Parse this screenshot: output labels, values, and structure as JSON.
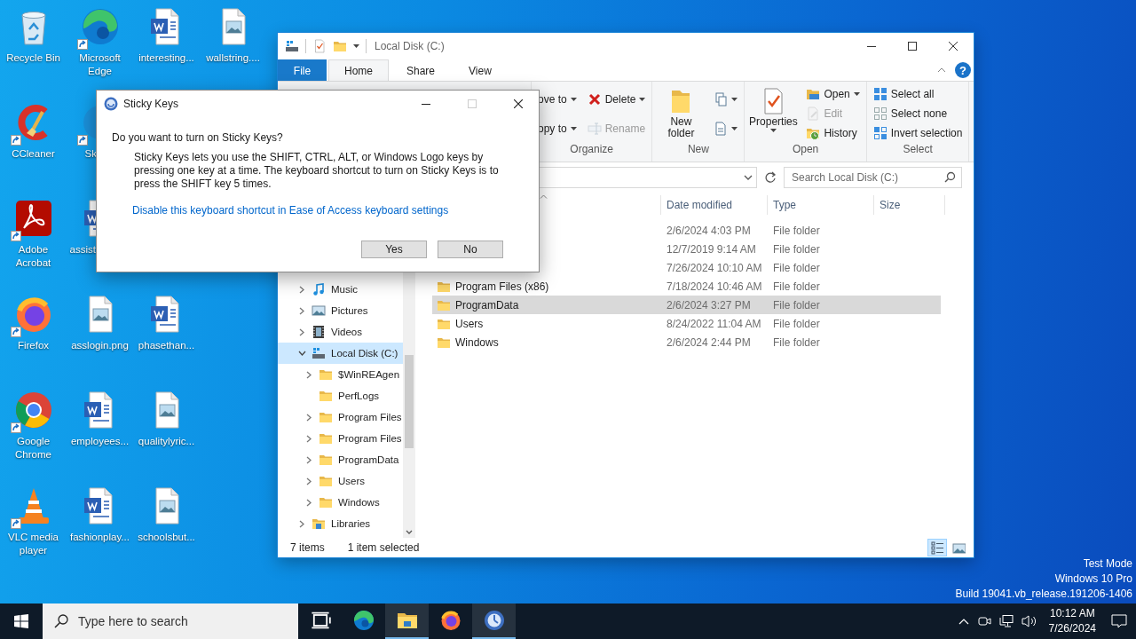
{
  "desktop_icons": [
    {
      "label": "Recycle Bin",
      "kind": "recycle",
      "shortcut": false
    },
    {
      "label": "Microsoft Edge",
      "kind": "edge",
      "shortcut": true
    },
    {
      "label": "interesting...",
      "kind": "word",
      "shortcut": false
    },
    {
      "label": "wallstring....",
      "kind": "image",
      "shortcut": false
    },
    {
      "label": "CCleaner",
      "kind": "ccleaner",
      "shortcut": true
    },
    {
      "label": "Sk",
      "kind": "skype",
      "shortcut": true
    },
    {
      "label": "Adobe Acrobat",
      "kind": "acrobat",
      "shortcut": true
    },
    {
      "label": "assist",
      "kind": "word",
      "shortcut": false
    },
    {
      "label": "Firefox",
      "kind": "firefox",
      "shortcut": true
    },
    {
      "label": "asslogin.png",
      "kind": "image",
      "shortcut": false
    },
    {
      "label": "phasethan...",
      "kind": "word",
      "shortcut": false
    },
    {
      "label": "Google Chrome",
      "kind": "chrome",
      "shortcut": true
    },
    {
      "label": "employees...",
      "kind": "word",
      "shortcut": false
    },
    {
      "label": "qualitylyric...",
      "kind": "image",
      "shortcut": false
    },
    {
      "label": "VLC media player",
      "kind": "vlc",
      "shortcut": true
    },
    {
      "label": "fashionplay...",
      "kind": "word",
      "shortcut": false
    },
    {
      "label": "schoolsbut...",
      "kind": "image",
      "shortcut": false
    }
  ],
  "explorer": {
    "title": "Local Disk (C:)",
    "tabs": [
      {
        "label": "File",
        "kind": "file",
        "selected": false
      },
      {
        "label": "Home",
        "kind": "tab",
        "selected": true
      },
      {
        "label": "Share",
        "kind": "tab",
        "selected": false
      },
      {
        "label": "View",
        "kind": "tab",
        "selected": false
      }
    ],
    "help": "?",
    "ribbon": [
      {
        "label": "Organize",
        "items": [
          {
            "label": "ove to",
            "kind": "move",
            "dropdown": true,
            "disabled": false
          },
          {
            "label": "opy to",
            "kind": "copy",
            "dropdown": true,
            "disabled": false
          },
          {
            "label": "Delete",
            "kind": "delete",
            "dropdown": true,
            "disabled": false
          },
          {
            "label": "Rename",
            "kind": "rename",
            "dropdown": false,
            "disabled": true
          }
        ]
      },
      {
        "label": "New",
        "items": [
          {
            "label": "New folder",
            "kind": "new-folder",
            "dropdown": false,
            "disabled": false
          },
          {
            "kind": "new-item",
            "dropdown": true,
            "disabled": false
          },
          {
            "kind": "easy-access",
            "dropdown": true,
            "disabled": false
          }
        ]
      },
      {
        "label": "Open",
        "items": [
          {
            "label": "Properties",
            "kind": "properties",
            "dropdown": true,
            "disabled": false
          },
          {
            "label": "Open",
            "kind": "open",
            "dropdown": true,
            "disabled": false
          },
          {
            "label": "Edit",
            "kind": "edit",
            "dropdown": false,
            "disabled": true
          },
          {
            "label": "History",
            "kind": "history",
            "dropdown": false,
            "disabled": false
          }
        ]
      },
      {
        "label": "Select",
        "items": [
          {
            "label": "Select all",
            "kind": "select-all",
            "dropdown": false,
            "disabled": false
          },
          {
            "label": "Select none",
            "kind": "select-none",
            "dropdown": false,
            "disabled": false
          },
          {
            "label": "Invert selection",
            "kind": "invert",
            "dropdown": false,
            "disabled": false
          }
        ]
      }
    ],
    "search_placeholder": "Search Local Disk (C:)",
    "columns": [
      "Date modified",
      "Type",
      "Size"
    ],
    "tree": [
      {
        "label": "Music",
        "kind": "music",
        "expandable": true,
        "expanded": false,
        "selected": false
      },
      {
        "label": "Pictures",
        "kind": "pictures",
        "expandable": true,
        "expanded": false,
        "selected": false
      },
      {
        "label": "Videos",
        "kind": "videos",
        "expandable": true,
        "expanded": false,
        "selected": false
      },
      {
        "label": "Local Disk (C:)",
        "kind": "drive",
        "expandable": true,
        "expanded": true,
        "selected": true,
        "children": [
          {
            "label": "$WinREAgen",
            "kind": "folder",
            "expandable": true,
            "expanded": false,
            "selected": false
          },
          {
            "label": "PerfLogs",
            "kind": "folder",
            "expandable": false,
            "expanded": false,
            "selected": false
          },
          {
            "label": "Program Files",
            "kind": "folder",
            "expandable": true,
            "expanded": false,
            "selected": false
          },
          {
            "label": "Program Files",
            "kind": "folder",
            "expandable": true,
            "expanded": false,
            "selected": false
          },
          {
            "label": "ProgramData",
            "kind": "folder",
            "expandable": true,
            "expanded": false,
            "selected": false
          },
          {
            "label": "Users",
            "kind": "folder",
            "expandable": true,
            "expanded": false,
            "selected": false
          },
          {
            "label": "Windows",
            "kind": "folder",
            "expandable": true,
            "expanded": false,
            "selected": false
          }
        ]
      },
      {
        "label": "Libraries",
        "kind": "libraries",
        "expandable": true,
        "expanded": false,
        "selected": false
      }
    ],
    "rows": [
      {
        "date": "2/6/2024 4:03 PM",
        "type": "File folder",
        "selected": false
      },
      {
        "date": "12/7/2019 9:14 AM",
        "type": "File folder",
        "selected": false
      },
      {
        "date": "7/26/2024 10:10 AM",
        "type": "File folder",
        "selected": false
      },
      {
        "name": "Program Files (x86)",
        "date": "7/18/2024 10:46 AM",
        "type": "File folder",
        "selected": false
      },
      {
        "name": "ProgramData",
        "date": "2/6/2024 3:27 PM",
        "type": "File folder",
        "selected": true
      },
      {
        "name": "Users",
        "date": "8/24/2022 11:04 AM",
        "type": "File folder",
        "selected": false
      },
      {
        "name": "Windows",
        "date": "2/6/2024 2:44 PM",
        "type": "File folder",
        "selected": false
      }
    ],
    "status": {
      "count": "7 items",
      "selection": "1 item selected"
    },
    "views": [
      {
        "kind": "details",
        "selected": true
      },
      {
        "kind": "large-icons",
        "selected": false
      }
    ]
  },
  "dialog": {
    "title": "Sticky Keys",
    "question": "Do you want to turn on Sticky Keys?",
    "body": "Sticky Keys lets you use the SHIFT, CTRL, ALT, or Windows Logo keys by pressing one key at a time. The keyboard shortcut to turn on Sticky Keys is to press the SHIFT key 5 times.",
    "link": "Disable this keyboard shortcut in Ease of Access keyboard settings",
    "buttons": [
      "Yes",
      "No"
    ]
  },
  "os_build": [
    "Test Mode",
    "Windows 10 Pro",
    "Build 19041.vb_release.191206-1406"
  ],
  "taskbar": {
    "search_placeholder": "Type here to search",
    "apps": [
      {
        "kind": "task-view",
        "selected": false
      },
      {
        "kind": "edge",
        "selected": false
      },
      {
        "kind": "explorer",
        "selected": true
      },
      {
        "kind": "firefox",
        "selected": false
      },
      {
        "kind": "sticky-keys",
        "selected": true
      }
    ],
    "time": "10:12 AM",
    "date": "7/26/2024"
  }
}
